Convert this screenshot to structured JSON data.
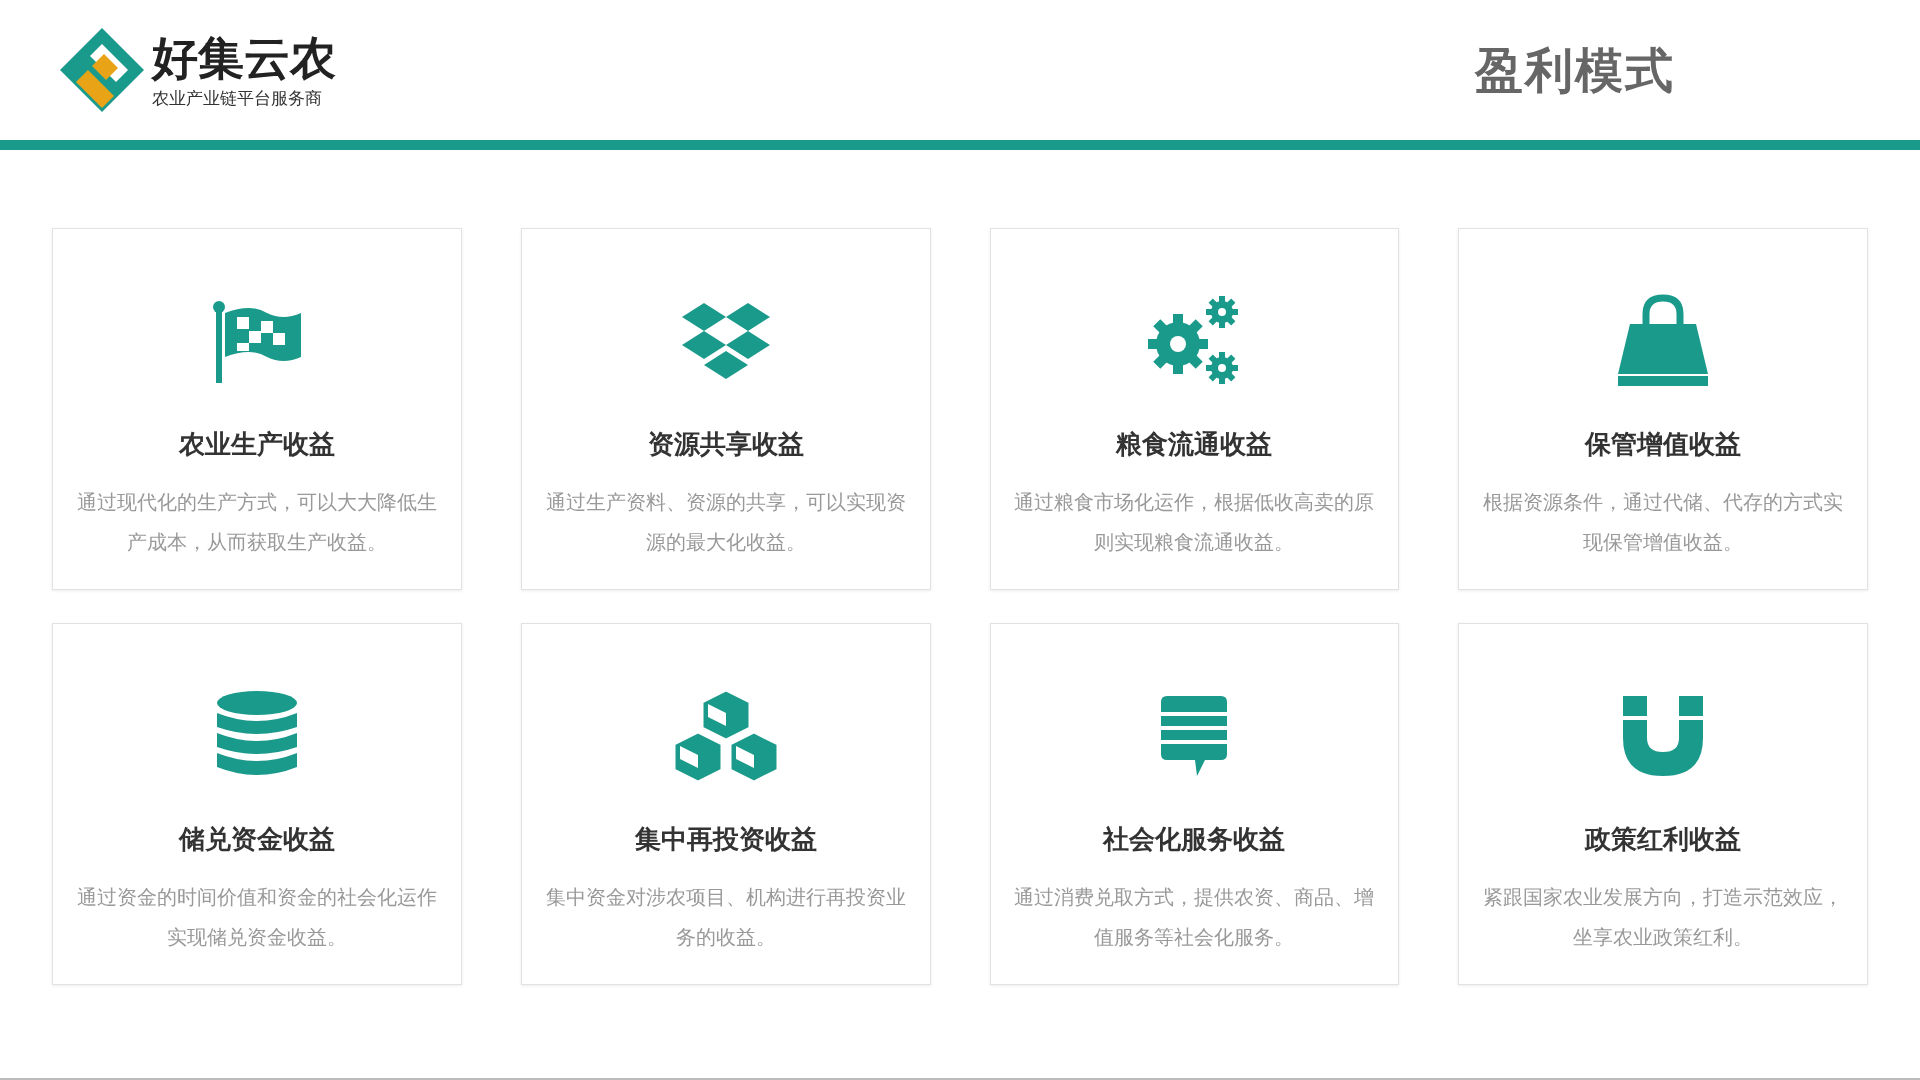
{
  "brand": {
    "name": "好集云农",
    "tagline": "农业产业链平台服务商"
  },
  "page_title": "盈利模式",
  "cards": [
    {
      "title": "农业生产收益",
      "description": "通过现代化的生产方式，可以大大降低生产成本，从而获取生产收益。"
    },
    {
      "title": "资源共享收益",
      "description": "通过生产资料、资源的共享，可以实现资源的最大化收益。"
    },
    {
      "title": "粮食流通收益",
      "description": "通过粮食市场化运作，根据低收高卖的原则实现粮食流通收益。"
    },
    {
      "title": "保管增值收益",
      "description": "根据资源条件，通过代储、代存的方式实现保管增值收益。"
    },
    {
      "title": "储兑资金收益",
      "description": "通过资金的时间价值和资金的社会化运作实现储兑资金收益。"
    },
    {
      "title": "集中再投资收益",
      "description": "集中资金对涉农项目、机构进行再投资业务的收益。"
    },
    {
      "title": "社会化服务收益",
      "description": "通过消费兑取方式，提供农资、商品、增值服务等社会化服务。"
    },
    {
      "title": "政策红利收益",
      "description": "紧跟国家农业发展方向，打造示范效应，坐享农业政策红利。"
    }
  ]
}
